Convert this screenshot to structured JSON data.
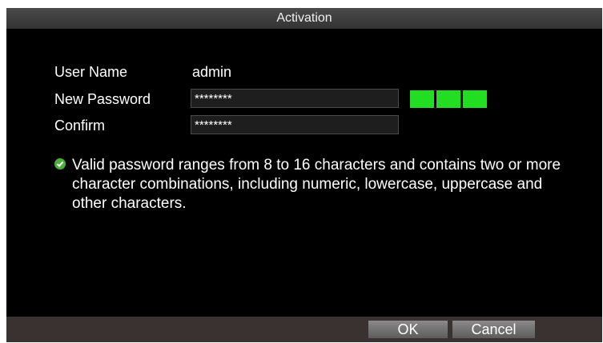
{
  "dialog": {
    "title": "Activation"
  },
  "form": {
    "username_label": "User Name",
    "username_value": "admin",
    "new_password_label": "New Password",
    "new_password_value": "********",
    "confirm_label": "Confirm",
    "confirm_value": "********",
    "strength_segments_filled": 3,
    "strength_color": "#22dd22"
  },
  "hint": {
    "icon": "check-circle-icon",
    "text": "Valid password ranges from 8 to 16 characters and contains two or more character combinations, including numeric, lowercase, uppercase and other characters."
  },
  "buttons": {
    "ok_label": "OK",
    "cancel_label": "Cancel"
  }
}
